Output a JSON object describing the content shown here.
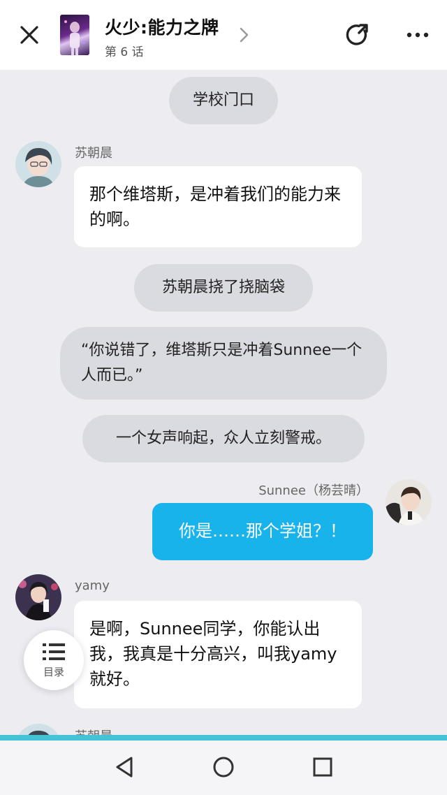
{
  "header": {
    "title": "火少:能力之牌",
    "episode": "第 6 话"
  },
  "chat": {
    "narration_1": "学校门口",
    "msg_1": {
      "speaker": "苏朝晨",
      "text": "那个维塔斯，是冲着我们的能力来的啊。"
    },
    "narration_2": "苏朝晨挠了挠脑袋",
    "narration_3": "“你说错了，维塔斯只是冲着Sunnee一个人而已。”",
    "narration_4": "一个女声响起，众人立刻警戒。",
    "msg_2": {
      "speaker": "Sunnee（杨芸晴）",
      "text": "你是……那个学姐？！"
    },
    "msg_3": {
      "speaker": "yamy",
      "text": "是啊，Sunnee同学，你能认出我，我真是十分高兴，叫我yamy就好。"
    },
    "msg_4": {
      "speaker": "苏朝晨"
    }
  },
  "toc": {
    "label": "目录"
  },
  "colors": {
    "self_bubble": "#19b3ec",
    "narration_bg": "#dadae1",
    "progress": "#44c2d6"
  },
  "icons": {
    "close": "close-icon",
    "title_arrow": "chevron-right-icon",
    "share": "share-icon",
    "more": "more-icon",
    "toc": "list-icon",
    "back": "back-triangle-icon",
    "home": "home-circle-icon",
    "recents": "recents-square-icon"
  }
}
